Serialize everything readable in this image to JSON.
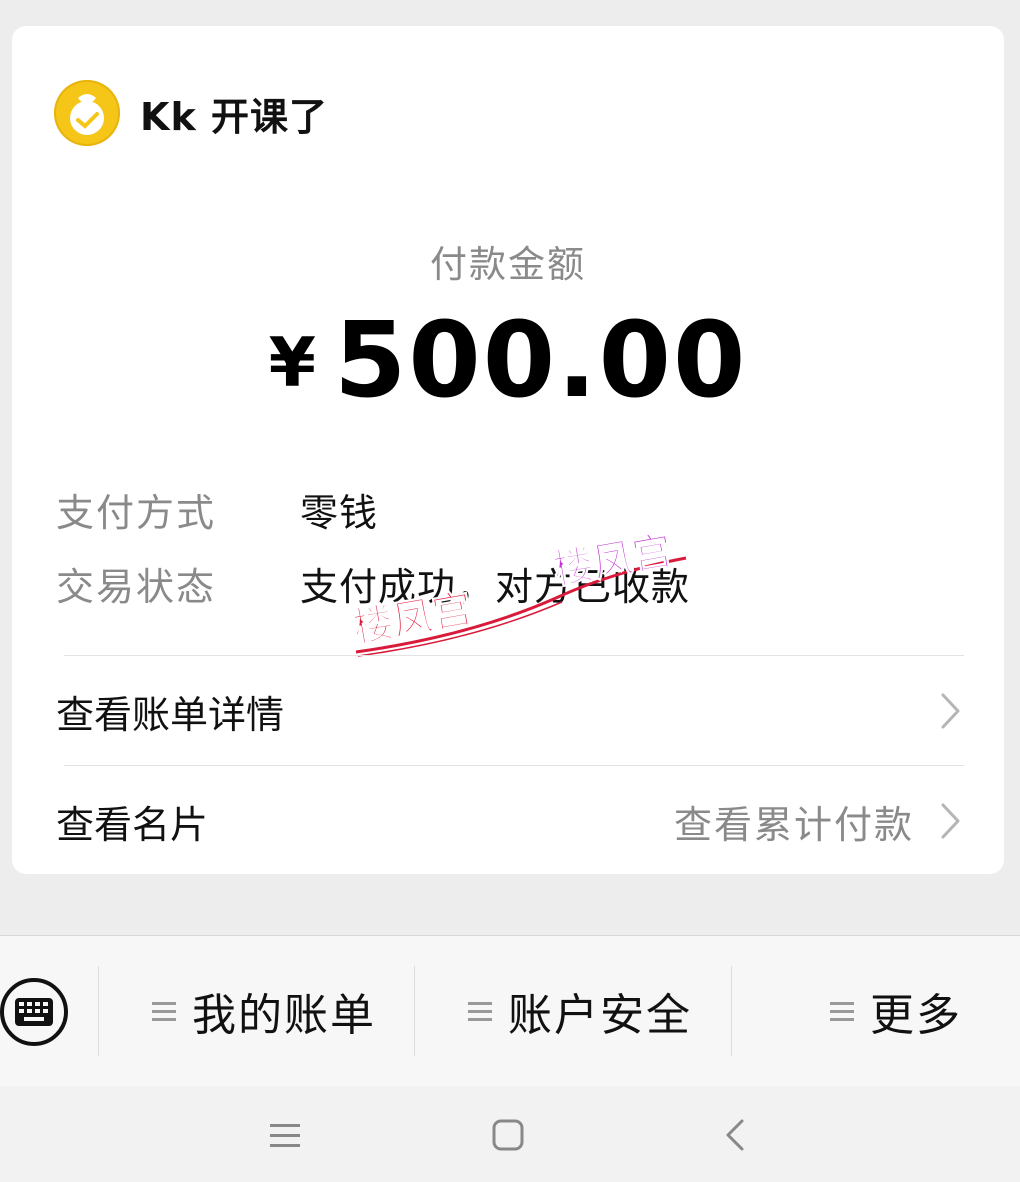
{
  "merchant": {
    "name": "Kk 开课了",
    "logo_icon": "kk-logo-icon",
    "logo_color": "#f5c518"
  },
  "payment": {
    "label": "付款金额",
    "currency": "¥",
    "amount": "500.00"
  },
  "details": [
    {
      "key": "支付方式",
      "value": "零钱"
    },
    {
      "key": "交易状态",
      "value": "支付成功，对方已收款"
    }
  ],
  "links": {
    "bill_details": "查看账单详情",
    "business_card": "查看名片",
    "cumulative_payment": "查看累计付款"
  },
  "watermarks": [
    "楼凤宫",
    "楼凤宫"
  ],
  "menu": {
    "keyboard_icon": "keyboard-icon",
    "items": [
      "我的账单",
      "账户安全",
      "更多"
    ]
  },
  "nav": {
    "icons": [
      "menu-icon",
      "home-icon",
      "back-icon"
    ]
  }
}
